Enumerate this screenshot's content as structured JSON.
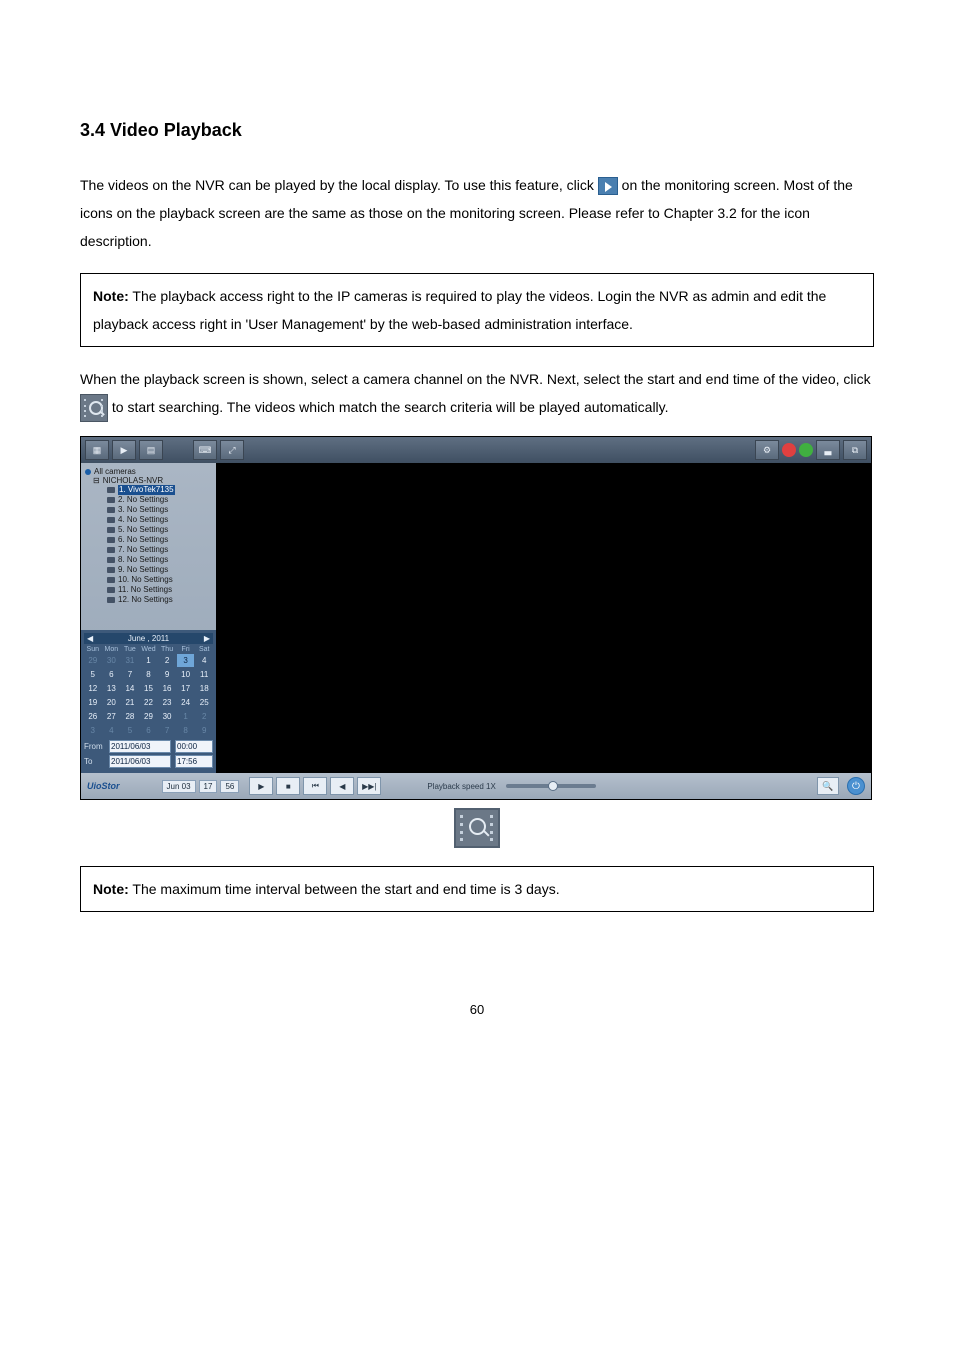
{
  "heading": "3.4   Video Playback",
  "para1_a": "The videos on the NVR can be played by the local display.   To use this feature, click ",
  "para1_b": " on the monitoring screen.   Most of the icons on the playback screen are the same as those on the monitoring screen.   Please refer to Chapter 3.2 for the icon description.",
  "note1_label": "Note:",
  "note1_text": " The playback access right to the IP cameras is required to play the videos.   Login the NVR as admin and edit the playback access right in 'User Management' by the web-based administration interface.",
  "para2_a": "When the playback screen is shown, select a camera channel on the NVR.   Next, select the start and end time of the video, click ",
  "para2_b": " to start searching.   The videos which match the search criteria will be played automatically.",
  "note2_label": "Note:",
  "note2_text": " The maximum time interval between the start and end time is 3 days.",
  "page_number": "60",
  "screenshot": {
    "tree": {
      "root": "All cameras",
      "nvr": "NICHOLAS-NVR",
      "selected": "1. VivoTek7135",
      "cams": [
        "2. No Settings",
        "3. No Settings",
        "4. No Settings",
        "5. No Settings",
        "6. No Settings",
        "7. No Settings",
        "8. No Settings",
        "9. No Settings",
        "10. No Settings",
        "11. No Settings",
        "12. No Settings"
      ]
    },
    "calendar": {
      "title": "June , 2011",
      "dow": [
        "Sun",
        "Mon",
        "Tue",
        "Wed",
        "Thu",
        "Fri",
        "Sat"
      ],
      "rows": [
        [
          "29",
          "30",
          "31",
          "1",
          "2",
          "3",
          "4"
        ],
        [
          "5",
          "6",
          "7",
          "8",
          "9",
          "10",
          "11"
        ],
        [
          "12",
          "13",
          "14",
          "15",
          "16",
          "17",
          "18"
        ],
        [
          "19",
          "20",
          "21",
          "22",
          "23",
          "24",
          "25"
        ],
        [
          "26",
          "27",
          "28",
          "29",
          "30",
          "1",
          "2"
        ],
        [
          "3",
          "4",
          "5",
          "6",
          "7",
          "8",
          "9"
        ]
      ],
      "selected_day": "3"
    },
    "from": {
      "label": "From",
      "date": "2011/06/03",
      "time": "00:00"
    },
    "to": {
      "label": "To",
      "date": "2011/06/03",
      "time": "17:56"
    },
    "footer": {
      "brand": "UioStor",
      "date_chip": [
        "Jun 03",
        "17",
        "56"
      ],
      "buttons": [
        "▶",
        "■",
        "⏮",
        "◀",
        "▶▶|"
      ],
      "speed_label": "Playback speed 1X",
      "magnify": "🔍",
      "power": "⏻"
    }
  }
}
